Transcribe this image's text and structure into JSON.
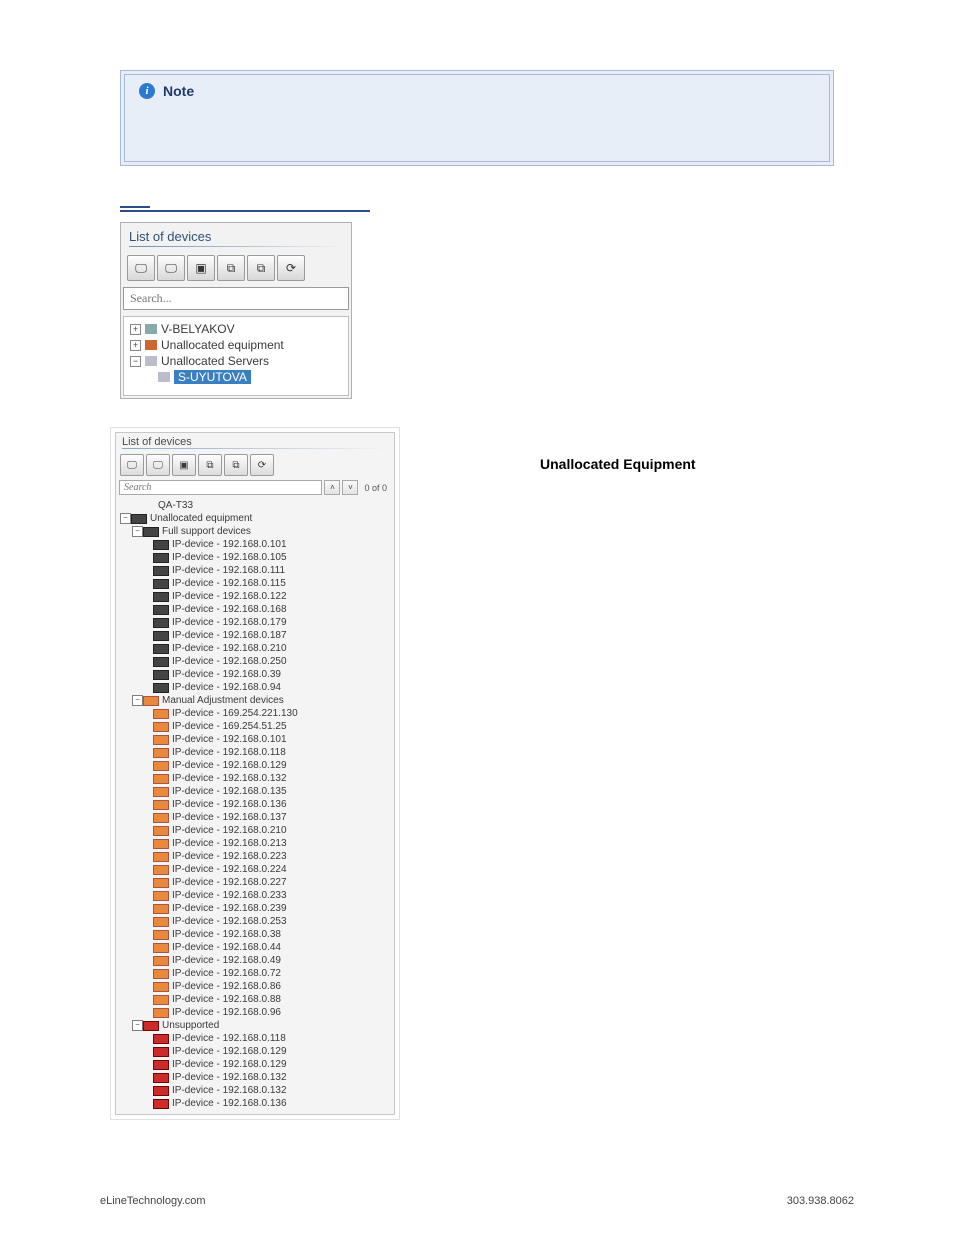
{
  "note": {
    "label": "Note"
  },
  "panel1": {
    "title": "List of devices",
    "search_placeholder": "Search...",
    "tree": {
      "item1": "V-BELYAKOV",
      "item2": "Unallocated equipment",
      "item3": "Unallocated Servers",
      "item4": "S-UYUTOVA"
    }
  },
  "section_heading": "Unallocated Equipment",
  "panel2": {
    "title": "List of devices",
    "search_placeholder": "Search",
    "count": "0 of 0",
    "root1": "QA-T33",
    "unalloc": "Unallocated equipment",
    "full_support": "Full support devices",
    "full_support_items": [
      "IP-device - 192.168.0.101",
      "IP-device - 192.168.0.105",
      "IP-device - 192.168.0.111",
      "IP-device - 192.168.0.115",
      "IP-device - 192.168.0.122",
      "IP-device - 192.168.0.168",
      "IP-device - 192.168.0.179",
      "IP-device - 192.168.0.187",
      "IP-device - 192.168.0.210",
      "IP-device - 192.168.0.250",
      "IP-device - 192.168.0.39",
      "IP-device - 192.168.0.94"
    ],
    "manual": "Manual Adjustment devices",
    "manual_items": [
      "IP-device - 169.254.221.130",
      "IP-device - 169.254.51.25",
      "IP-device - 192.168.0.101",
      "IP-device - 192.168.0.118",
      "IP-device - 192.168.0.129",
      "IP-device - 192.168.0.132",
      "IP-device - 192.168.0.135",
      "IP-device - 192.168.0.136",
      "IP-device - 192.168.0.137",
      "IP-device - 192.168.0.210",
      "IP-device - 192.168.0.213",
      "IP-device - 192.168.0.223",
      "IP-device - 192.168.0.224",
      "IP-device - 192.168.0.227",
      "IP-device - 192.168.0.233",
      "IP-device - 192.168.0.239",
      "IP-device - 192.168.0.253",
      "IP-device - 192.168.0.38",
      "IP-device - 192.168.0.44",
      "IP-device - 192.168.0.49",
      "IP-device - 192.168.0.72",
      "IP-device - 192.168.0.86",
      "IP-device - 192.168.0.88",
      "IP-device - 192.168.0.96"
    ],
    "unsupported": "Unsupported",
    "unsupported_items": [
      "IP-device - 192.168.0.118",
      "IP-device - 192.168.0.129",
      "IP-device - 192.168.0.129",
      "IP-device - 192.168.0.132",
      "IP-device - 192.168.0.132",
      "IP-device - 192.168.0.136"
    ]
  },
  "footer": {
    "left": "eLineTechnology.com",
    "right": "303.938.8062"
  }
}
